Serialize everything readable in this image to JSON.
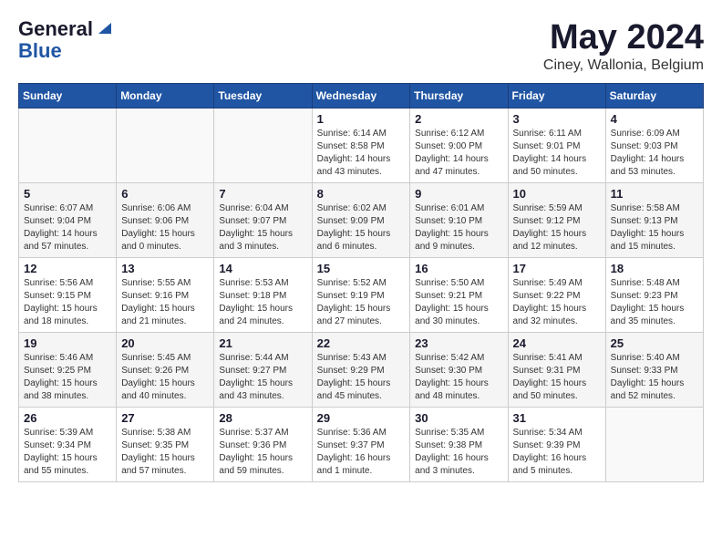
{
  "header": {
    "logo_general": "General",
    "logo_blue": "Blue",
    "title": "May 2024",
    "subtitle": "Ciney, Wallonia, Belgium"
  },
  "weekdays": [
    "Sunday",
    "Monday",
    "Tuesday",
    "Wednesday",
    "Thursday",
    "Friday",
    "Saturday"
  ],
  "weeks": [
    [
      {
        "day": "",
        "info": ""
      },
      {
        "day": "",
        "info": ""
      },
      {
        "day": "",
        "info": ""
      },
      {
        "day": "1",
        "info": "Sunrise: 6:14 AM\nSunset: 8:58 PM\nDaylight: 14 hours\nand 43 minutes."
      },
      {
        "day": "2",
        "info": "Sunrise: 6:12 AM\nSunset: 9:00 PM\nDaylight: 14 hours\nand 47 minutes."
      },
      {
        "day": "3",
        "info": "Sunrise: 6:11 AM\nSunset: 9:01 PM\nDaylight: 14 hours\nand 50 minutes."
      },
      {
        "day": "4",
        "info": "Sunrise: 6:09 AM\nSunset: 9:03 PM\nDaylight: 14 hours\nand 53 minutes."
      }
    ],
    [
      {
        "day": "5",
        "info": "Sunrise: 6:07 AM\nSunset: 9:04 PM\nDaylight: 14 hours\nand 57 minutes."
      },
      {
        "day": "6",
        "info": "Sunrise: 6:06 AM\nSunset: 9:06 PM\nDaylight: 15 hours\nand 0 minutes."
      },
      {
        "day": "7",
        "info": "Sunrise: 6:04 AM\nSunset: 9:07 PM\nDaylight: 15 hours\nand 3 minutes."
      },
      {
        "day": "8",
        "info": "Sunrise: 6:02 AM\nSunset: 9:09 PM\nDaylight: 15 hours\nand 6 minutes."
      },
      {
        "day": "9",
        "info": "Sunrise: 6:01 AM\nSunset: 9:10 PM\nDaylight: 15 hours\nand 9 minutes."
      },
      {
        "day": "10",
        "info": "Sunrise: 5:59 AM\nSunset: 9:12 PM\nDaylight: 15 hours\nand 12 minutes."
      },
      {
        "day": "11",
        "info": "Sunrise: 5:58 AM\nSunset: 9:13 PM\nDaylight: 15 hours\nand 15 minutes."
      }
    ],
    [
      {
        "day": "12",
        "info": "Sunrise: 5:56 AM\nSunset: 9:15 PM\nDaylight: 15 hours\nand 18 minutes."
      },
      {
        "day": "13",
        "info": "Sunrise: 5:55 AM\nSunset: 9:16 PM\nDaylight: 15 hours\nand 21 minutes."
      },
      {
        "day": "14",
        "info": "Sunrise: 5:53 AM\nSunset: 9:18 PM\nDaylight: 15 hours\nand 24 minutes."
      },
      {
        "day": "15",
        "info": "Sunrise: 5:52 AM\nSunset: 9:19 PM\nDaylight: 15 hours\nand 27 minutes."
      },
      {
        "day": "16",
        "info": "Sunrise: 5:50 AM\nSunset: 9:21 PM\nDaylight: 15 hours\nand 30 minutes."
      },
      {
        "day": "17",
        "info": "Sunrise: 5:49 AM\nSunset: 9:22 PM\nDaylight: 15 hours\nand 32 minutes."
      },
      {
        "day": "18",
        "info": "Sunrise: 5:48 AM\nSunset: 9:23 PM\nDaylight: 15 hours\nand 35 minutes."
      }
    ],
    [
      {
        "day": "19",
        "info": "Sunrise: 5:46 AM\nSunset: 9:25 PM\nDaylight: 15 hours\nand 38 minutes."
      },
      {
        "day": "20",
        "info": "Sunrise: 5:45 AM\nSunset: 9:26 PM\nDaylight: 15 hours\nand 40 minutes."
      },
      {
        "day": "21",
        "info": "Sunrise: 5:44 AM\nSunset: 9:27 PM\nDaylight: 15 hours\nand 43 minutes."
      },
      {
        "day": "22",
        "info": "Sunrise: 5:43 AM\nSunset: 9:29 PM\nDaylight: 15 hours\nand 45 minutes."
      },
      {
        "day": "23",
        "info": "Sunrise: 5:42 AM\nSunset: 9:30 PM\nDaylight: 15 hours\nand 48 minutes."
      },
      {
        "day": "24",
        "info": "Sunrise: 5:41 AM\nSunset: 9:31 PM\nDaylight: 15 hours\nand 50 minutes."
      },
      {
        "day": "25",
        "info": "Sunrise: 5:40 AM\nSunset: 9:33 PM\nDaylight: 15 hours\nand 52 minutes."
      }
    ],
    [
      {
        "day": "26",
        "info": "Sunrise: 5:39 AM\nSunset: 9:34 PM\nDaylight: 15 hours\nand 55 minutes."
      },
      {
        "day": "27",
        "info": "Sunrise: 5:38 AM\nSunset: 9:35 PM\nDaylight: 15 hours\nand 57 minutes."
      },
      {
        "day": "28",
        "info": "Sunrise: 5:37 AM\nSunset: 9:36 PM\nDaylight: 15 hours\nand 59 minutes."
      },
      {
        "day": "29",
        "info": "Sunrise: 5:36 AM\nSunset: 9:37 PM\nDaylight: 16 hours\nand 1 minute."
      },
      {
        "day": "30",
        "info": "Sunrise: 5:35 AM\nSunset: 9:38 PM\nDaylight: 16 hours\nand 3 minutes."
      },
      {
        "day": "31",
        "info": "Sunrise: 5:34 AM\nSunset: 9:39 PM\nDaylight: 16 hours\nand 5 minutes."
      },
      {
        "day": "",
        "info": ""
      }
    ]
  ]
}
